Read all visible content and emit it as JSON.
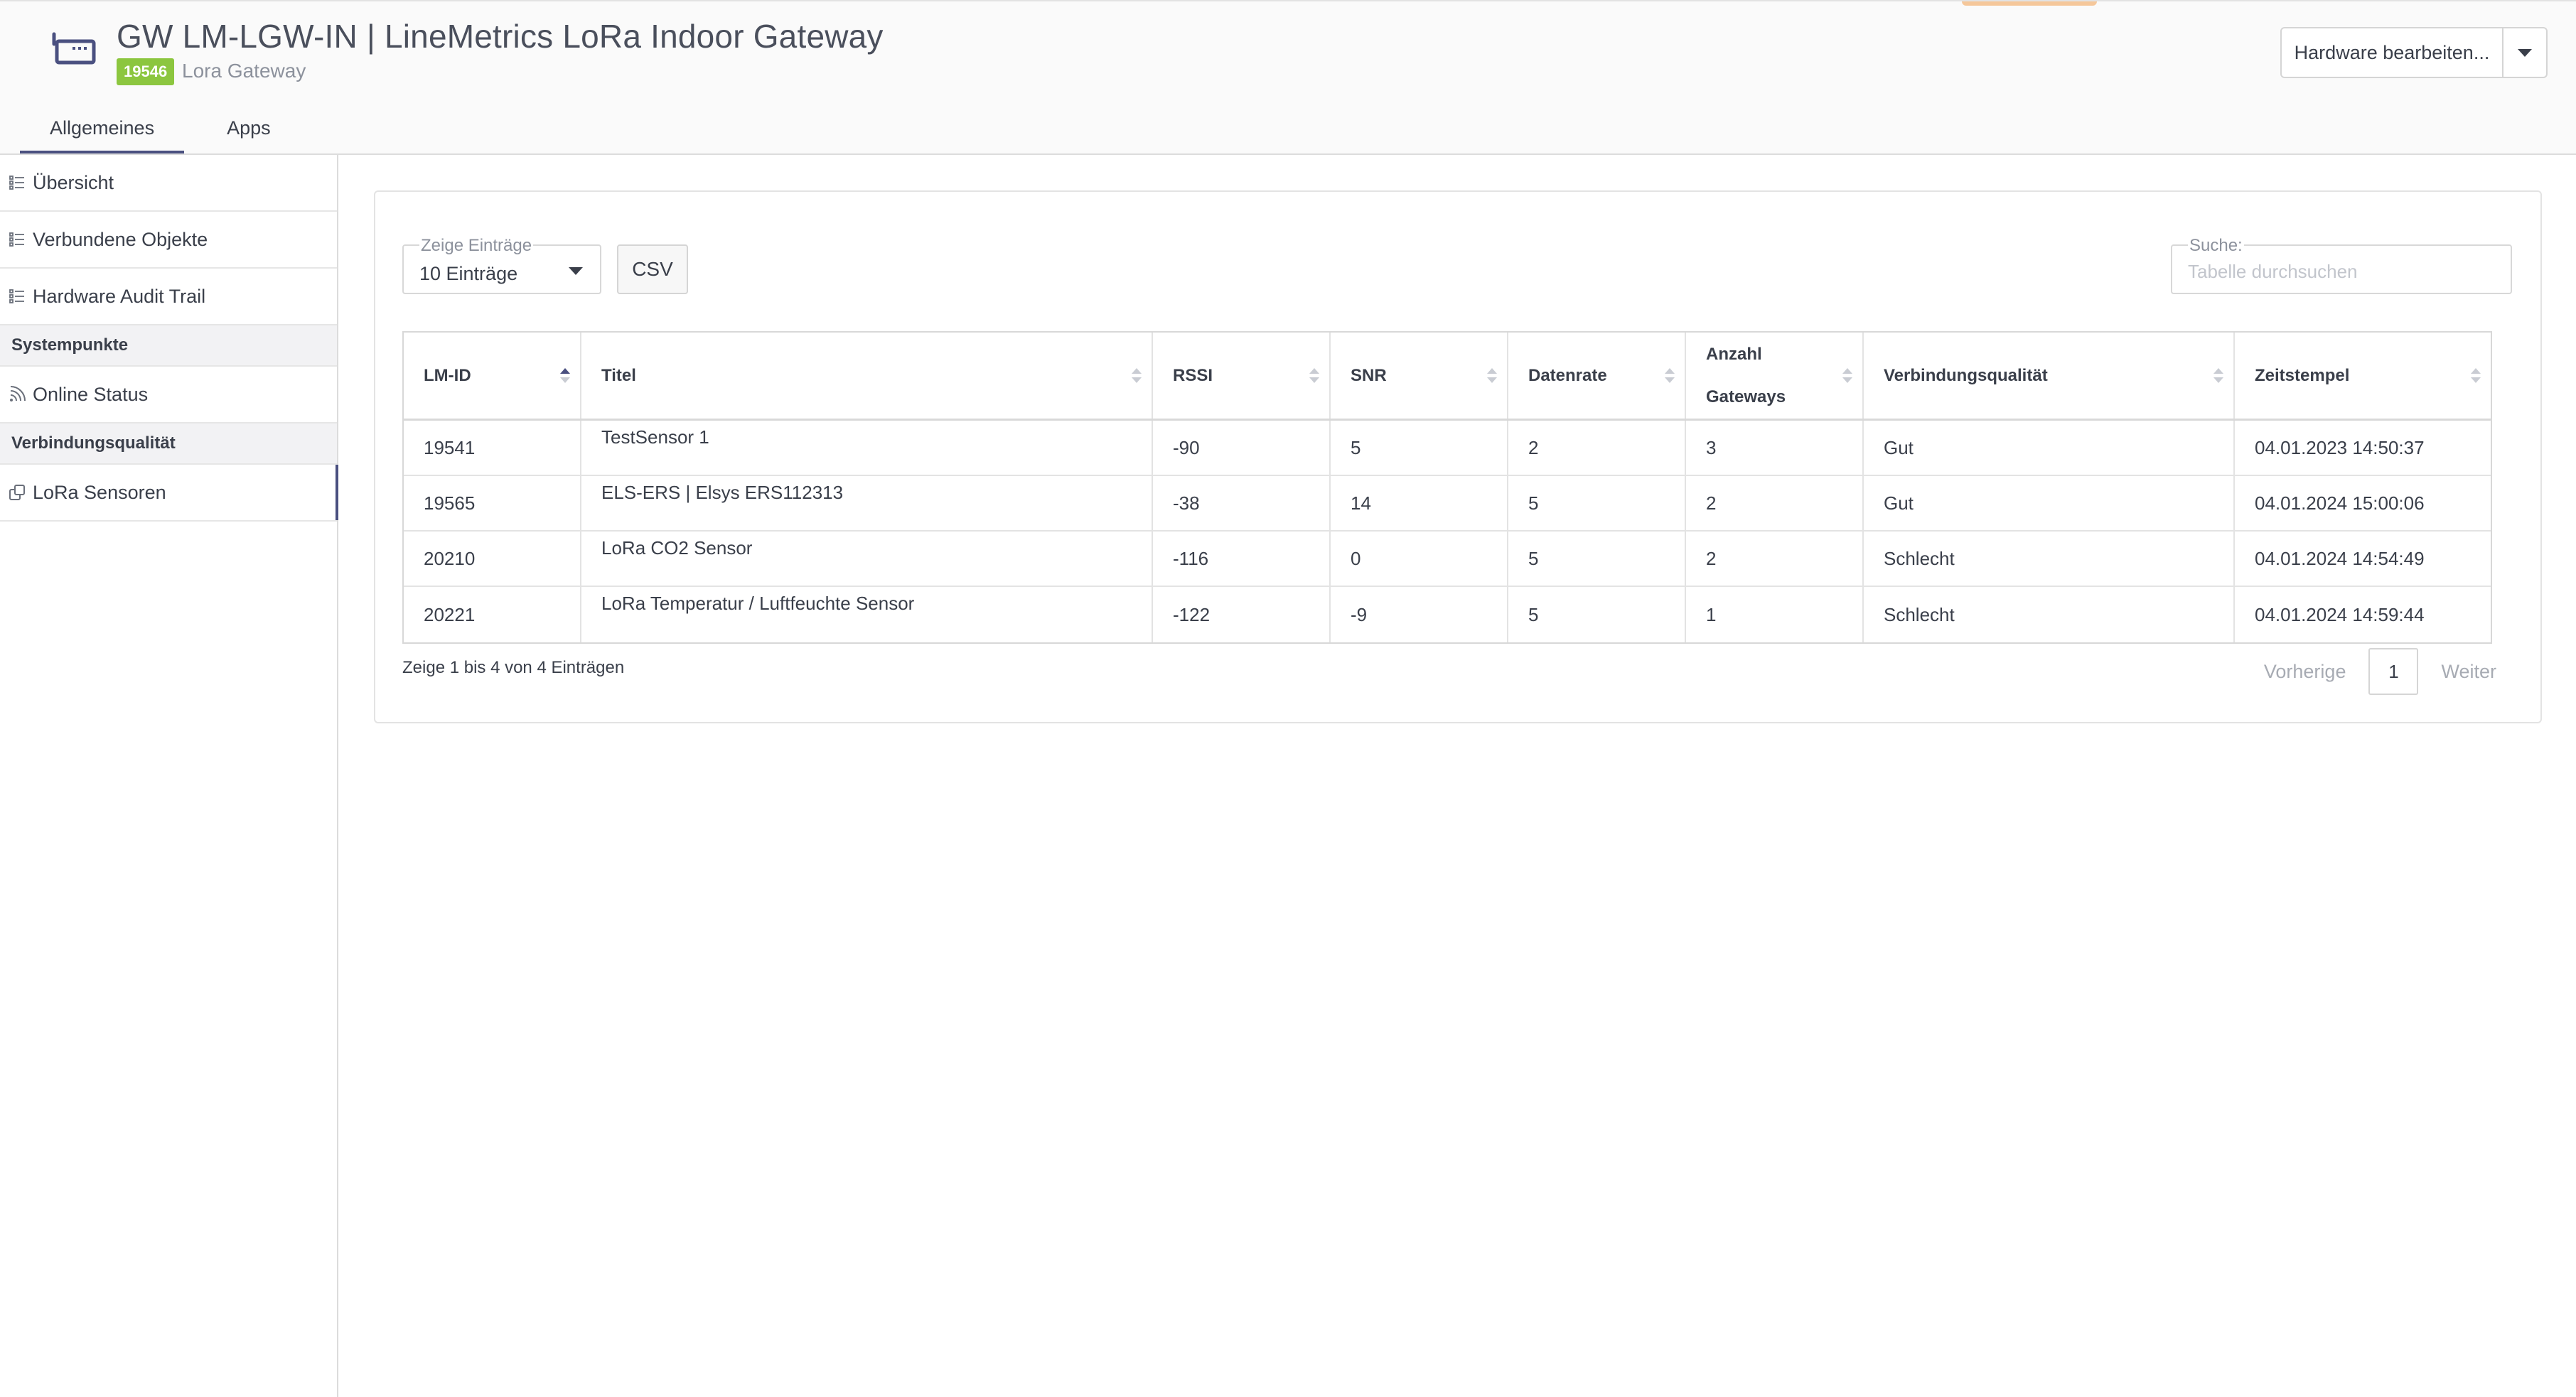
{
  "header": {
    "title": "GW LM-LGW-IN | LineMetrics LoRa Indoor Gateway",
    "badge": "19546",
    "subtype": "Lora Gateway",
    "edit_button": "Hardware bearbeiten...",
    "gateway_icon": "gateway-icon",
    "badge_color": "#8cc63f"
  },
  "tabs": [
    {
      "label": "Allgemeines",
      "active": true
    },
    {
      "label": "Apps",
      "active": false
    }
  ],
  "sidebar": {
    "items": [
      {
        "label": "Übersicht",
        "icon": "list-icon"
      },
      {
        "label": "Verbundene Objekte",
        "icon": "list-icon"
      },
      {
        "label": "Hardware Audit Trail",
        "icon": "list-icon"
      }
    ],
    "section_systempunkte": "Systempunkte",
    "online_status": {
      "label": "Online Status",
      "icon": "signal-icon"
    },
    "section_verbindung": "Verbindungsqualität",
    "lora_sensoren": {
      "label": "LoRa Sensoren",
      "icon": "link-icon",
      "active": true
    }
  },
  "controls": {
    "length_legend": "Zeige Einträge",
    "length_value": "10 Einträge",
    "csv_label": "CSV",
    "search_legend": "Suche:",
    "search_placeholder": "Tabelle durchsuchen"
  },
  "table": {
    "columns": [
      {
        "label": "LM-ID",
        "sort": "asc"
      },
      {
        "label": "Titel",
        "sort": "none"
      },
      {
        "label": "RSSI",
        "sort": "none"
      },
      {
        "label": "SNR",
        "sort": "none"
      },
      {
        "label": "Datenrate",
        "sort": "none"
      },
      {
        "label": "Anzahl Gateways",
        "sort": "none"
      },
      {
        "label": "Verbindungsqualität",
        "sort": "none"
      },
      {
        "label": "Zeitstempel",
        "sort": "none"
      }
    ],
    "rows": [
      [
        "19541",
        "TestSensor 1",
        "-90",
        "5",
        "2",
        "3",
        "Gut",
        "04.01.2023 14:50:37"
      ],
      [
        "19565",
        "ELS-ERS | Elsys ERS112313",
        "-38",
        "14",
        "5",
        "2",
        "Gut",
        "04.01.2024 15:00:06"
      ],
      [
        "20210",
        "LoRa CO2 Sensor",
        "-116",
        "0",
        "5",
        "2",
        "Schlecht",
        "04.01.2024 14:54:49"
      ],
      [
        "20221",
        "LoRa Temperatur / Luftfeuchte Sensor",
        "-122",
        "-9",
        "5",
        "1",
        "Schlecht",
        "04.01.2024 14:59:44"
      ]
    ]
  },
  "footer": {
    "info": "Zeige 1 bis 4 von 4 Einträgen",
    "prev": "Vorherige",
    "page": "1",
    "next": "Weiter"
  }
}
